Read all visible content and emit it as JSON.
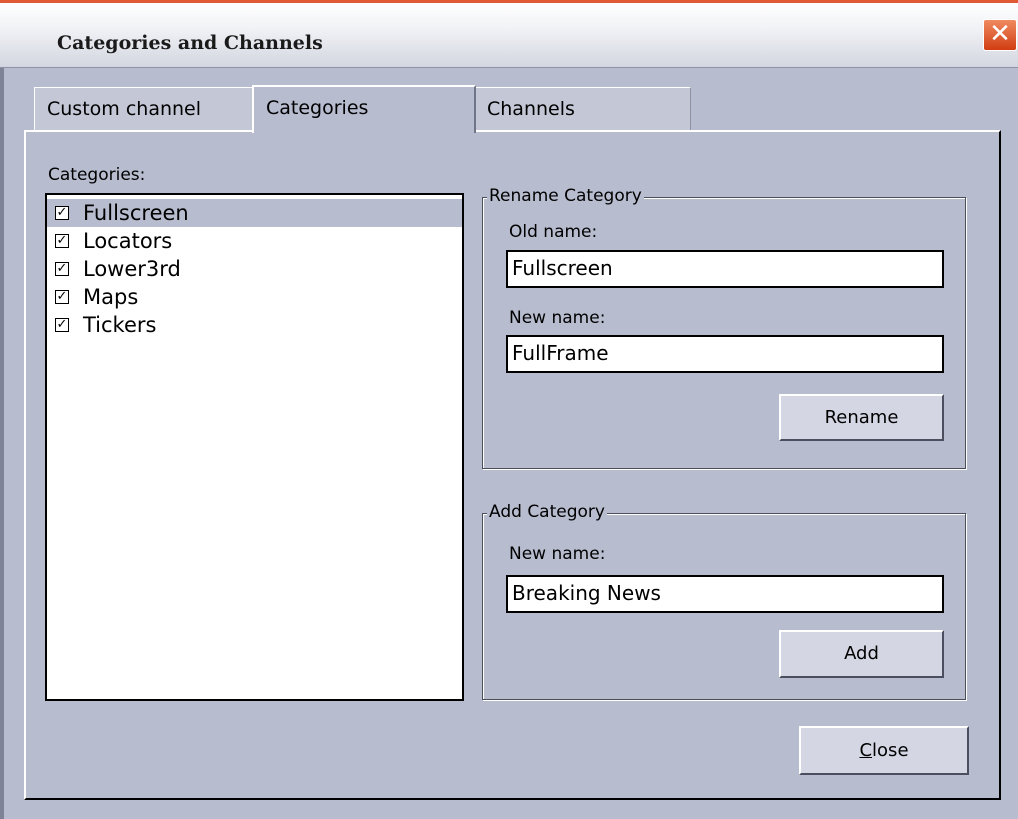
{
  "window": {
    "title": "Categories and Channels",
    "close_glyph": "✕"
  },
  "tabs": [
    {
      "label": "Custom channel",
      "active": false
    },
    {
      "label": "Categories",
      "active": true
    },
    {
      "label": "Channels",
      "active": false
    }
  ],
  "categories_list": {
    "label": "Categories:",
    "items": [
      {
        "label": "Fullscreen",
        "checked": true,
        "selected": true
      },
      {
        "label": "Locators",
        "checked": true,
        "selected": false
      },
      {
        "label": "Lower3rd",
        "checked": true,
        "selected": false
      },
      {
        "label": "Maps",
        "checked": true,
        "selected": false
      },
      {
        "label": "Tickers",
        "checked": true,
        "selected": false
      }
    ]
  },
  "rename_category": {
    "title": "Rename Category",
    "old_name_label": "Old name:",
    "old_name_value": "Fullscreen",
    "new_name_label": "New name:",
    "new_name_value": "FullFrame",
    "button_label": "Rename"
  },
  "add_category": {
    "title": "Add Category",
    "new_name_label": "New name:",
    "new_name_value": "Breaking News",
    "button_label": "Add"
  },
  "footer": {
    "close_label_accel": "C",
    "close_label_rest": "lose"
  },
  "colors": {
    "dialog_bg": "#b7bccf",
    "selection": "#b7bccf",
    "close_x_red": "#d23d12"
  }
}
